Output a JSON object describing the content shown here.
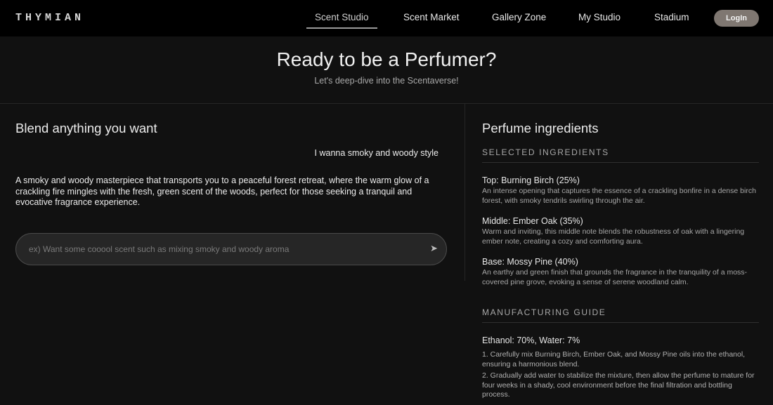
{
  "app": {
    "logo": "THYMIAN"
  },
  "nav": {
    "items": [
      {
        "label": "Scent Studio",
        "active": true
      },
      {
        "label": "Scent Market",
        "active": false
      },
      {
        "label": "Gallery Zone",
        "active": false
      },
      {
        "label": "My Studio",
        "active": false
      },
      {
        "label": "Stadium",
        "active": false
      }
    ],
    "login_label": "LogIn"
  },
  "hero": {
    "title": "Ready to be a Perfumer?",
    "subtitle": "Let's deep-dive into the Scentaverse!"
  },
  "blend": {
    "title": "Blend anything you want",
    "user_message": "I wanna smoky and woody style",
    "ai_message": "A smoky and woody masterpiece that transports you to a peaceful forest retreat, where the warm glow of a crackling fire mingles with the fresh, green scent of the woods, perfect for those seeking a tranquil and evocative fragrance experience.",
    "input_placeholder": "ex) Want some cooool scent such as mixing smoky and woody aroma",
    "send_icon": "send-arrow"
  },
  "ingredients": {
    "title": "Perfume ingredients",
    "selected_heading": "SELECTED INGREDIENTS",
    "items": [
      {
        "name": "Top: Burning Birch (25%)",
        "description": "An intense opening that captures the essence of a crackling bonfire in a dense birch forest, with smoky tendrils swirling through the air."
      },
      {
        "name": "Middle: Ember Oak (35%)",
        "description": "Warm and inviting, this middle note blends the robustness of oak with a lingering ember note, creating a cozy and comforting aura."
      },
      {
        "name": "Base: Mossy Pine (40%)",
        "description": "An earthy and green finish that grounds the fragrance in the tranquility of a moss-covered pine grove, evoking a sense of serene woodland calm."
      }
    ],
    "guide_heading": "MANUFACTURING GUIDE",
    "guide_ratio": "Ethanol: 70%, Water: 7%",
    "guide_steps": [
      "1. Carefully mix Burning Birch, Ember Oak, and Mossy Pine oils into the ethanol, ensuring a harmonious blend.",
      "2. Gradually add water to stabilize the mixture, then allow the perfume to mature for four weeks in a shady, cool environment before the final filtration and bottling process."
    ]
  }
}
